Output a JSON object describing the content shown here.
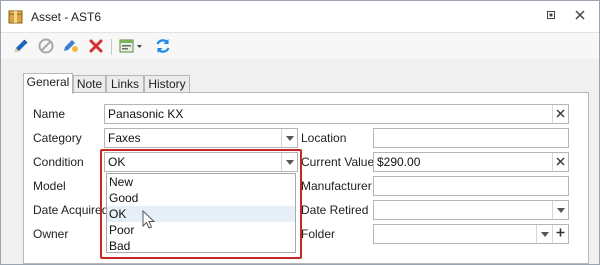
{
  "window": {
    "title": "Asset - AST6"
  },
  "tabs": [
    {
      "label": "General",
      "active": true
    },
    {
      "label": "Note",
      "active": false
    },
    {
      "label": "Links",
      "active": false
    },
    {
      "label": "History",
      "active": false
    }
  ],
  "form": {
    "name": {
      "label": "Name",
      "value": "Panasonic KX"
    },
    "category": {
      "label": "Category",
      "value": "Faxes"
    },
    "condition": {
      "label": "Condition",
      "value": "OK"
    },
    "model": {
      "label": "Model"
    },
    "date_acquired": {
      "label": "Date Acquired"
    },
    "owner": {
      "label": "Owner"
    },
    "location": {
      "label": "Location",
      "value": ""
    },
    "current_value": {
      "label": "Current Value",
      "value": "$290.00"
    },
    "manufacturer": {
      "label": "Manufacturer",
      "value": ""
    },
    "date_retired": {
      "label": "Date Retired",
      "value": ""
    },
    "folder": {
      "label": "Folder",
      "value": ""
    }
  },
  "condition_options": [
    "New",
    "Good",
    "OK",
    "Poor",
    "Bad"
  ],
  "colors": {
    "highlight": "#c62828",
    "edit_icon": "#1a66c2",
    "delete_icon": "#d32f2f",
    "refresh_icon": "#1e88e5"
  },
  "icons": {
    "window_icon": "asset-box-icon",
    "close": "close-icon",
    "tb": [
      "edit-pencil-icon",
      "cancel-circle-icon",
      "edit-tag-icon",
      "delete-x-icon",
      "properties-dropdown-icon",
      "refresh-icon"
    ]
  }
}
